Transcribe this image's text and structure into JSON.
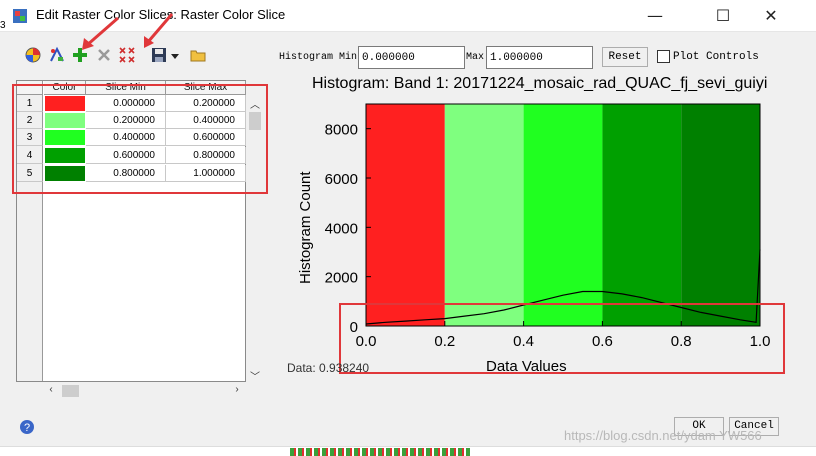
{
  "window": {
    "title": "Edit Raster Color Slices: Raster Color Slice",
    "minimize": "—",
    "maximize": "☐",
    "close": "✕"
  },
  "histogram_controls": {
    "min_label": "Histogram Min",
    "min_value": "0.000000",
    "max_label": "Max",
    "max_value": "1.000000",
    "reset_label": "Reset",
    "plot_controls_label": "Plot Controls"
  },
  "table": {
    "headers": [
      "Color",
      "Slice Min",
      "Slice Max"
    ],
    "rows": [
      {
        "index": "1",
        "color": "#ff2020",
        "min": "0.000000",
        "max": "0.200000"
      },
      {
        "index": "2",
        "color": "#7fff7f",
        "min": "0.200000",
        "max": "0.400000"
      },
      {
        "index": "3",
        "color": "#20ff20",
        "min": "0.400000",
        "max": "0.600000"
      },
      {
        "index": "4",
        "color": "#00a000",
        "min": "0.600000",
        "max": "0.800000"
      },
      {
        "index": "5",
        "color": "#008000",
        "min": "0.800000",
        "max": "1.000000"
      }
    ]
  },
  "status": {
    "data_readout": "Data: 0.938240"
  },
  "buttons": {
    "ok": "OK",
    "cancel": "Cancel"
  },
  "watermark": "https://blog.csdn.net/ydam YW566",
  "side_number": "3",
  "chart_data": {
    "type": "area",
    "title": "Histogram: Band 1: 20171224_mosaic_rad_QUAC_fj_sevi_guiyi",
    "xlabel": "Data Values",
    "ylabel": "Histogram Count",
    "xlim": [
      0.0,
      1.0
    ],
    "ylim": [
      0,
      9000
    ],
    "xticks": [
      "0.0",
      "0.2",
      "0.4",
      "0.6",
      "0.8",
      "1.0"
    ],
    "yticks": [
      "0",
      "2000",
      "4000",
      "6000",
      "8000"
    ],
    "slices": [
      {
        "from": 0.0,
        "to": 0.2,
        "color": "#ff2020"
      },
      {
        "from": 0.2,
        "to": 0.4,
        "color": "#7fff7f"
      },
      {
        "from": 0.4,
        "to": 0.6,
        "color": "#20ff20"
      },
      {
        "from": 0.6,
        "to": 0.8,
        "color": "#00a000"
      },
      {
        "from": 0.8,
        "to": 1.0,
        "color": "#008000"
      }
    ],
    "x": [
      0.0,
      0.05,
      0.1,
      0.15,
      0.2,
      0.25,
      0.3,
      0.35,
      0.4,
      0.45,
      0.5,
      0.55,
      0.6,
      0.65,
      0.7,
      0.75,
      0.8,
      0.85,
      0.9,
      0.95,
      0.99,
      1.0
    ],
    "values": [
      80,
      150,
      200,
      250,
      300,
      400,
      500,
      650,
      850,
      1050,
      1250,
      1400,
      1400,
      1300,
      1150,
      950,
      750,
      550,
      400,
      250,
      150,
      3100
    ]
  },
  "colors": {
    "annotation_red": "#e0373a"
  }
}
